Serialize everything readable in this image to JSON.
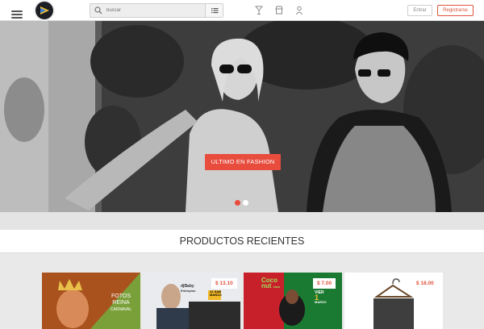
{
  "header": {
    "search_placeholder": "buscar",
    "enter_label": "Entrar",
    "register_label": "Registrarse"
  },
  "hero": {
    "cta_label": "ULTIMO EN FASHION",
    "slide_count": 2,
    "active_slide": 1
  },
  "section": {
    "title": "PRODUCTOS RECIENTES"
  },
  "products": [
    {
      "poster_text": [
        "FOTOS",
        "REINA",
        "CARNAVAL"
      ],
      "price": ""
    },
    {
      "poster_text": [
        "djBaby",
        "Entrepiso",
        "Vie",
        "12",
        "SAB",
        "MARZO"
      ],
      "price": "$ 13.10"
    },
    {
      "poster_text": [
        "Coco",
        "nut",
        "club",
        "VIER",
        "1",
        "MARZO"
      ],
      "price": "$ 7.00"
    },
    {
      "poster_text": [],
      "price": "$ 18.00"
    }
  ],
  "colors": {
    "accent": "#e84c3d",
    "topbar": "#ffffff",
    "page_bg": "#e9e9e9"
  }
}
